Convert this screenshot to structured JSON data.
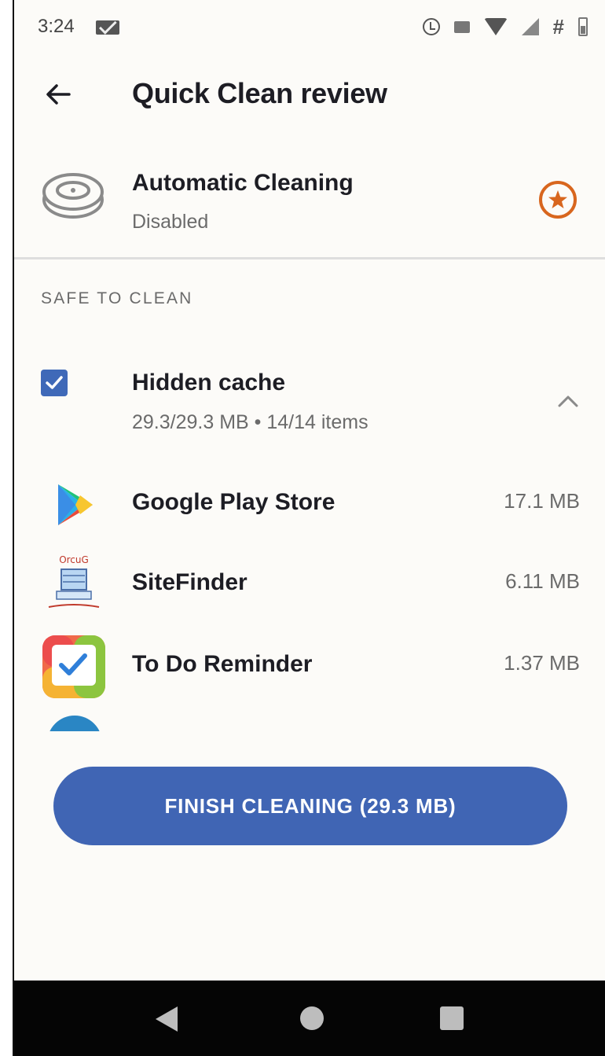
{
  "status_bar": {
    "time": "3:24",
    "icons": [
      "mail-icon",
      "alarm-icon",
      "cast-icon",
      "wifi-icon",
      "signal-icon",
      "hash-icon",
      "battery-icon"
    ]
  },
  "app_bar": {
    "back_icon": "arrow-left-icon",
    "title": "Quick Clean review"
  },
  "automatic_cleaning": {
    "icon": "robot-vacuum-icon",
    "title": "Automatic Cleaning",
    "status": "Disabled",
    "premium_icon": "star-circle-icon",
    "premium_color": "#d8661e"
  },
  "section": {
    "header": "SAFE TO CLEAN"
  },
  "group": {
    "checked": true,
    "title": "Hidden cache",
    "subtitle": "29.3/29.3 MB • 14/14 items",
    "expanded": true
  },
  "apps": [
    {
      "name": "Google Play Store",
      "size": "17.1 MB",
      "icon": "google-play-icon"
    },
    {
      "name": "SiteFinder",
      "size": "6.11 MB",
      "icon": "sitefinder-icon",
      "icon_text": "OrcuG"
    },
    {
      "name": "To Do Reminder",
      "size": "1.37 MB",
      "icon": "todo-reminder-icon"
    }
  ],
  "finish_button": {
    "label": "FINISH CLEANING (29.3 MB)",
    "color": "#4065b4"
  },
  "nav_bar": {
    "icons": [
      "back-triangle-icon",
      "home-circle-icon",
      "recents-square-icon"
    ]
  }
}
